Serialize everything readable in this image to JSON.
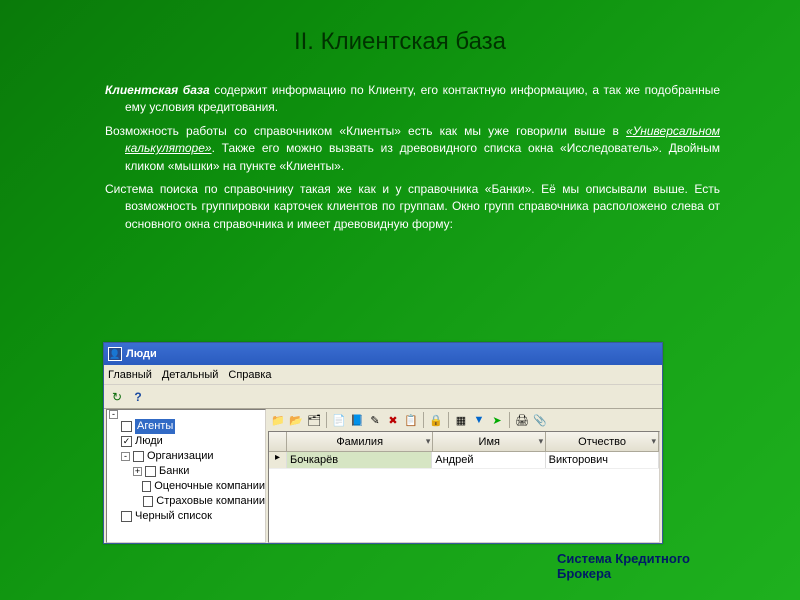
{
  "title": "II. Клиентская база",
  "para": {
    "term": "Клиентская база",
    "p1_rest": " содержит информацию по Клиенту, его контактную информацию, а так же подобранные ему условия кредитования.",
    "p2_a": "Возможность работы со справочником «Клиенты» есть как мы уже говорили выше в ",
    "p2_link": "«Универсальном калькуляторе»",
    "p2_b": ". Также его можно вызвать из древовидного списка окна «Исследователь». Двойным кликом «мышки» на пункте «Клиенты».",
    "p3": "Система поиска по справочнику такая же как и у справочника «Банки». Её мы описывали выше. Есть возможность группировки карточек клиентов по группам. Окно групп справочника расположено слева от основного окна справочника и имеет древовидную форму:"
  },
  "window": {
    "title": "Люди",
    "menu": [
      "Главный",
      "Детальный",
      "Справка"
    ],
    "toolbar_top": {
      "refresh": "↻",
      "help": "?"
    },
    "tree": {
      "agents": "Агенты",
      "people": "Люди",
      "orgs": "Организации",
      "banks": "Банки",
      "appraisal": "Оценочные компании",
      "insurance": "Страховые компании",
      "blacklist": "Черный список"
    },
    "toolbar_main_icons": [
      "folder-icon",
      "folder-open-icon",
      "delete-folder-icon",
      "new-doc-icon",
      "open-doc-icon",
      "edit-doc-icon",
      "delete-doc-icon",
      "copy-icon",
      "lock-icon",
      "filter-icon",
      "funnel-icon",
      "arrow-icon",
      "print-icon",
      "attach-icon"
    ],
    "columns": {
      "c1": "Фамилия",
      "c2": "Имя",
      "c3": "Отчество"
    },
    "row": {
      "lastname": "Бочкарёв",
      "firstname": "Андрей",
      "patronymic": "Викторович"
    }
  },
  "footer": {
    "l1": "Система Кредитного",
    "l2": "Брокера"
  },
  "glyph": {
    "folder": "📁",
    "folder_open": "📂",
    "del_folder": "🗂",
    "new": "📄",
    "open": "📘",
    "edit": "✎",
    "del": "✖",
    "copy": "📋",
    "lock": "🔒",
    "filter": "▦",
    "funnel": "▼",
    "arrow": "➤",
    "print": "🖨",
    "clip": "📎",
    "tri": "▾",
    "rowmark": "▸"
  }
}
